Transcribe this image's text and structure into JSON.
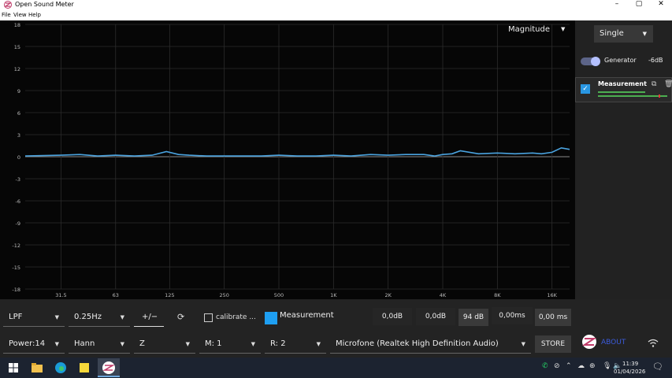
{
  "window": {
    "title": "Open Sound Meter",
    "minimize": "–",
    "maximize": "▢",
    "close": "✕"
  },
  "menu": {
    "file": "File",
    "view": "View",
    "help": "Help"
  },
  "plot": {
    "mode": "Magnitude",
    "y_ticks": [
      "18",
      "15",
      "12",
      "9",
      "6",
      "3",
      "0",
      "-3",
      "-6",
      "-9",
      "-12",
      "-15",
      "-18"
    ],
    "x_ticks": [
      "31.5",
      "63",
      "125",
      "250",
      "500",
      "1K",
      "2K",
      "4K",
      "8K",
      "16K"
    ]
  },
  "chart_data": {
    "type": "line",
    "xscale": "log",
    "xlim": [
      20,
      20000
    ],
    "ylim": [
      -18,
      18
    ],
    "grid": true,
    "series": [
      {
        "name": "Measurement",
        "color": "#4aa3df",
        "x": [
          20,
          31.5,
          40,
          50,
          63,
          80,
          100,
          120,
          140,
          160,
          200,
          250,
          315,
          400,
          500,
          630,
          800,
          1000,
          1250,
          1600,
          2000,
          2500,
          3150,
          3600,
          4000,
          4500,
          5000,
          6300,
          8000,
          10000,
          12500,
          14000,
          16000,
          18000,
          20000
        ],
        "y": [
          0.1,
          0.2,
          0.3,
          0.1,
          0.2,
          0.1,
          0.2,
          0.7,
          0.3,
          0.2,
          0.1,
          0.1,
          0.1,
          0.1,
          0.2,
          0.1,
          0.1,
          0.2,
          0.1,
          0.3,
          0.2,
          0.3,
          0.3,
          0.1,
          0.3,
          0.4,
          0.8,
          0.4,
          0.5,
          0.4,
          0.5,
          0.4,
          0.6,
          1.2,
          1.0
        ]
      }
    ]
  },
  "right": {
    "mode": "Single",
    "generator_label": "Generator",
    "generator_level": "-6dB",
    "generator_on": true,
    "measurement_name": "Measurement",
    "measurement_checked": true
  },
  "bottom": {
    "filter": "LPF",
    "freq": "0.25Hz",
    "plusminus": "+/−",
    "calibrate": "calibrate ...",
    "measurement_name": "Measurement",
    "measurement_color": "#1e9ff2",
    "val1": "0,0dB",
    "val2": "0,0dB",
    "val3": "94 dB",
    "val4": "0,00ms",
    "val5": "0,00 ms",
    "power": "Power:14",
    "window": "Hann",
    "weight": "Z",
    "m": "M: 1",
    "r": "R: 2",
    "device": "Microfone (Realtek High Definition Audio)",
    "store": "STORE",
    "about": "ABOUT"
  },
  "taskbar": {
    "time": "11:39",
    "date": "01/04/2026"
  }
}
